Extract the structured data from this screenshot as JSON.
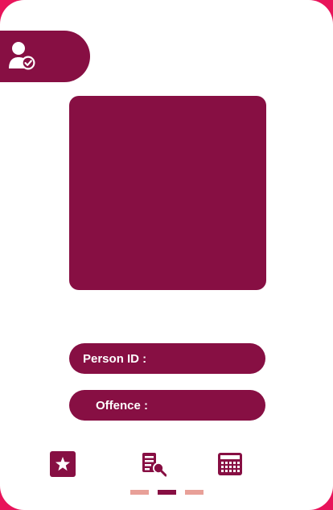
{
  "profile": {
    "icon": "user-check-icon",
    "photo_placeholder_color": "#870f43"
  },
  "fields": {
    "person_id_label": "Person ID :",
    "person_id_value": "",
    "offence_label": "Offence :",
    "offence_value": ""
  },
  "nav": {
    "items": [
      {
        "icon": "star-icon"
      },
      {
        "icon": "document-search-icon"
      },
      {
        "icon": "calculator-icon"
      }
    ]
  },
  "pager": {
    "pages": 3,
    "active_index": 1
  },
  "colors": {
    "accent": "#870f43",
    "frame": "#e8145a",
    "inactive_dot": "#e8a098",
    "background": "#ffffff"
  }
}
